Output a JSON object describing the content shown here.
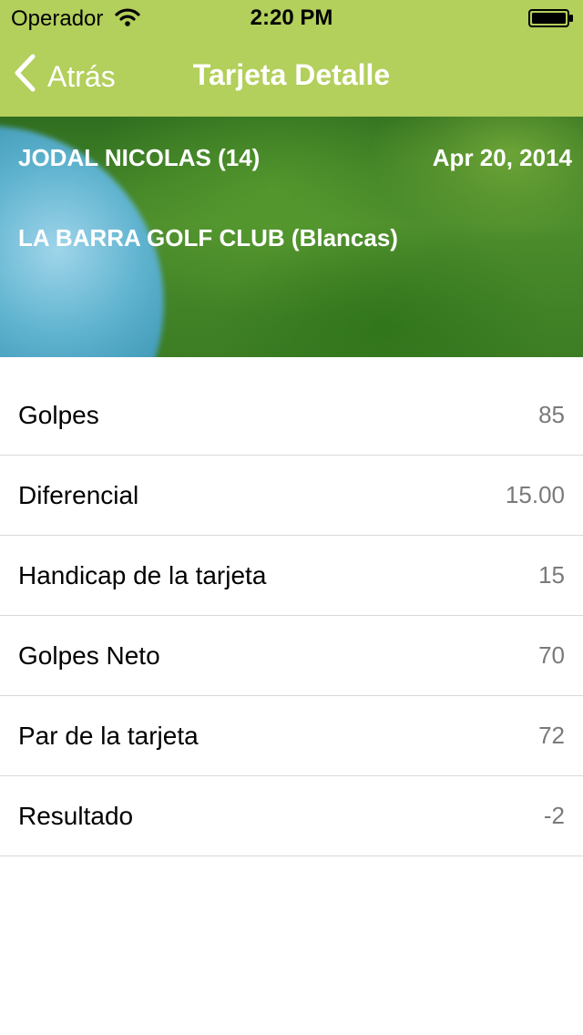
{
  "status_bar": {
    "carrier": "Operador",
    "time": "2:20 PM"
  },
  "nav": {
    "back_label": "Atrás",
    "title": "Tarjeta Detalle"
  },
  "card": {
    "player": "JODAL NICOLAS (14)",
    "date": "Apr 20, 2014",
    "course": "LA BARRA GOLF CLUB (Blancas)"
  },
  "rows": [
    {
      "label": "Golpes",
      "value": "85"
    },
    {
      "label": "Diferencial",
      "value": "15.00"
    },
    {
      "label": "Handicap de la tarjeta",
      "value": "15"
    },
    {
      "label": "Golpes Neto",
      "value": "70"
    },
    {
      "label": "Par de la tarjeta",
      "value": "72"
    },
    {
      "label": "Resultado",
      "value": "-2"
    }
  ],
  "colors": {
    "nav_background": "#b3cf5c",
    "value_text": "#7a7a7a"
  },
  "icons": {
    "wifi": "wifi-icon",
    "battery": "battery-icon",
    "back": "chevron-left-icon"
  }
}
